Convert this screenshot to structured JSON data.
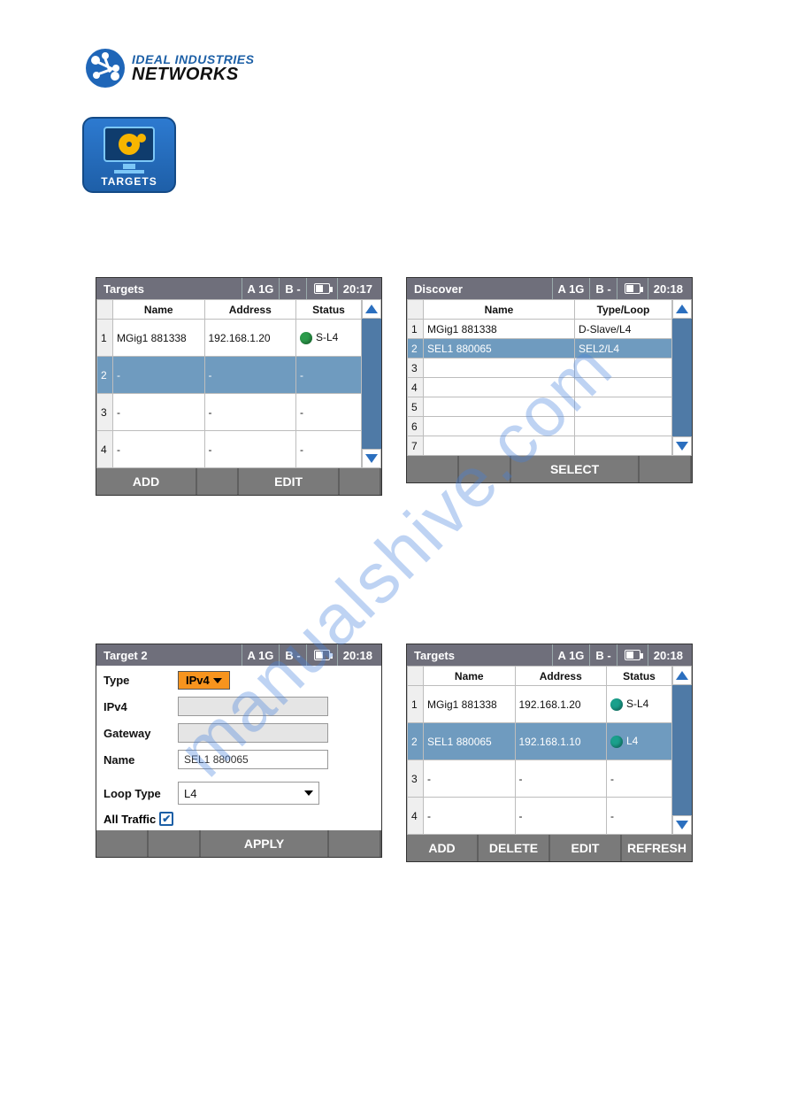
{
  "brand": {
    "line1": "IDEAL INDUSTRIES",
    "line2": "NETWORKS"
  },
  "app_icon": {
    "label": "TARGETS"
  },
  "watermark": "manualshive.com",
  "panel1": {
    "title": "Targets",
    "port_a": "A 1G",
    "port_b": "B -",
    "time": "20:17",
    "headers": {
      "name": "Name",
      "address": "Address",
      "status": "Status"
    },
    "rows": [
      {
        "idx": "1",
        "name": "MGig1 881338",
        "address": "192.168.1.20",
        "status": "S-L4"
      },
      {
        "idx": "2",
        "name": "-",
        "address": "-",
        "status": "-"
      },
      {
        "idx": "3",
        "name": "-",
        "address": "-",
        "status": "-"
      },
      {
        "idx": "4",
        "name": "-",
        "address": "-",
        "status": "-"
      }
    ],
    "footer": {
      "add": "ADD",
      "edit": "EDIT"
    }
  },
  "panel2": {
    "title": "Discover",
    "port_a": "A 1G",
    "port_b": "B -",
    "time": "20:18",
    "headers": {
      "name": "Name",
      "type": "Type/Loop"
    },
    "rows": [
      {
        "idx": "1",
        "name": "MGig1 881338",
        "type": "D-Slave/L4"
      },
      {
        "idx": "2",
        "name": "SEL1 880065",
        "type": "SEL2/L4",
        "selected": true
      },
      {
        "idx": "3",
        "name": "",
        "type": ""
      },
      {
        "idx": "4",
        "name": "",
        "type": ""
      },
      {
        "idx": "5",
        "name": "",
        "type": ""
      },
      {
        "idx": "6",
        "name": "",
        "type": ""
      },
      {
        "idx": "7",
        "name": "",
        "type": ""
      }
    ],
    "footer": {
      "select": "SELECT"
    }
  },
  "panel3": {
    "title": "Target 2",
    "port_a": "A 1G",
    "port_b": "B -",
    "time": "20:18",
    "form": {
      "type_label": "Type",
      "type_value": "IPv4",
      "ipv4_label": "IPv4",
      "ipv4_value": "",
      "gateway_label": "Gateway",
      "gateway_value": "",
      "name_label": "Name",
      "name_value": "SEL1 880065",
      "loop_label": "Loop Type",
      "loop_value": "L4",
      "alltraffic_label": "All Traffic",
      "alltraffic_checked": true
    },
    "footer": {
      "apply": "APPLY"
    }
  },
  "panel4": {
    "title": "Targets",
    "port_a": "A 1G",
    "port_b": "B -",
    "time": "20:18",
    "headers": {
      "name": "Name",
      "address": "Address",
      "status": "Status"
    },
    "rows": [
      {
        "idx": "1",
        "name": "MGig1 881338",
        "address": "192.168.1.20",
        "status": "S-L4"
      },
      {
        "idx": "2",
        "name": "SEL1 880065",
        "address": "192.168.1.10",
        "status": "L4",
        "selected": true
      },
      {
        "idx": "3",
        "name": "-",
        "address": "-",
        "status": "-"
      },
      {
        "idx": "4",
        "name": "-",
        "address": "-",
        "status": "-"
      }
    ],
    "footer": {
      "add": "ADD",
      "delete": "DELETE",
      "edit": "EDIT",
      "refresh": "REFRESH"
    }
  }
}
